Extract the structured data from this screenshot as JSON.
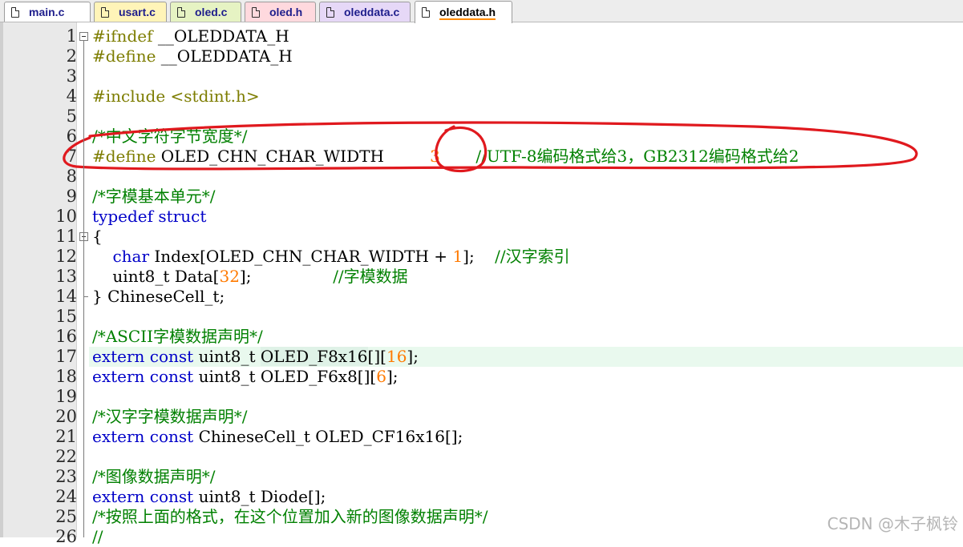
{
  "tabs": [
    {
      "label": "main.c",
      "color": "#ffffff"
    },
    {
      "label": "usart.c",
      "color": "#fff4b8"
    },
    {
      "label": "oled.c",
      "color": "#e6f3c3"
    },
    {
      "label": "oled.h",
      "color": "#ffd9de"
    },
    {
      "label": "oleddata.c",
      "color": "#e6d8f7"
    },
    {
      "label": "oleddata.h",
      "color": "#ffffff",
      "active": true
    }
  ],
  "icons": {
    "file": "file-icon",
    "fold": "fold-collapse-icon"
  },
  "colors": {
    "preprocessor": "#7d7d00",
    "keyword": "#0000c8",
    "number": "#ff7a00",
    "comment": "#008000",
    "annotation": "#e0191e",
    "current_line": "#e9f9ee"
  },
  "code": [
    {
      "n": "1",
      "tokens": [
        [
          "pp",
          "#ifndef"
        ],
        [
          "pl",
          " __OLEDDATA_H"
        ]
      ]
    },
    {
      "n": "2",
      "tokens": [
        [
          "pp",
          "#define"
        ],
        [
          "pl",
          " __OLEDDATA_H"
        ]
      ]
    },
    {
      "n": "3",
      "tokens": []
    },
    {
      "n": "4",
      "tokens": [
        [
          "pp",
          "#include <stdint.h>"
        ]
      ]
    },
    {
      "n": "5",
      "tokens": []
    },
    {
      "n": "6",
      "tokens": [
        [
          "cm",
          "/*中文字符字节宽度*/"
        ]
      ]
    },
    {
      "n": "7",
      "tokens": [
        [
          "pp",
          "#define"
        ],
        [
          "pl",
          " OLED_CHN_CHAR_WIDTH         "
        ],
        [
          "num",
          "3"
        ],
        [
          "pl",
          "       "
        ],
        [
          "cm",
          "//UTF-8编码格式给3，GB2312编码格式给2"
        ]
      ]
    },
    {
      "n": "8",
      "tokens": []
    },
    {
      "n": "9",
      "tokens": [
        [
          "cm",
          "/*字模基本单元*/"
        ]
      ]
    },
    {
      "n": "10",
      "tokens": [
        [
          "kw",
          "typedef struct"
        ]
      ]
    },
    {
      "n": "11",
      "tokens": [
        [
          "pl",
          "{"
        ]
      ]
    },
    {
      "n": "12",
      "tokens": [
        [
          "pl",
          "    "
        ],
        [
          "kw",
          "char"
        ],
        [
          "pl",
          " Index[OLED_CHN_CHAR_WIDTH + "
        ],
        [
          "num",
          "1"
        ],
        [
          "pl",
          "];    "
        ],
        [
          "cm",
          "//汉字索引"
        ]
      ]
    },
    {
      "n": "13",
      "tokens": [
        [
          "pl",
          "    uint8_t Data["
        ],
        [
          "num",
          "32"
        ],
        [
          "pl",
          "];                "
        ],
        [
          "cm",
          "//字模数据"
        ]
      ]
    },
    {
      "n": "14",
      "tokens": [
        [
          "pl",
          "} ChineseCell_t;"
        ]
      ]
    },
    {
      "n": "15",
      "tokens": []
    },
    {
      "n": "16",
      "tokens": [
        [
          "cm",
          "/*ASCII字模数据声明*/"
        ]
      ]
    },
    {
      "n": "17",
      "tokens": [
        [
          "kw",
          "extern const"
        ],
        [
          "pl",
          " uint8_t "
        ],
        [
          "sel",
          "OLED_F8x16"
        ],
        [
          "pl",
          "[]["
        ],
        [
          "num",
          "16"
        ],
        [
          "pl",
          "];"
        ]
      ],
      "current": true
    },
    {
      "n": "18",
      "tokens": [
        [
          "kw",
          "extern const"
        ],
        [
          "pl",
          " uint8_t OLED_F6x8[]["
        ],
        [
          "num",
          "6"
        ],
        [
          "pl",
          "];"
        ]
      ]
    },
    {
      "n": "19",
      "tokens": []
    },
    {
      "n": "20",
      "tokens": [
        [
          "cm",
          "/*汉字字模数据声明*/"
        ]
      ]
    },
    {
      "n": "21",
      "tokens": [
        [
          "kw",
          "extern const"
        ],
        [
          "pl",
          " ChineseCell_t OLED_CF16x16[];"
        ]
      ]
    },
    {
      "n": "22",
      "tokens": []
    },
    {
      "n": "23",
      "tokens": [
        [
          "cm",
          "/*图像数据声明*/"
        ]
      ]
    },
    {
      "n": "24",
      "tokens": [
        [
          "kw",
          "extern const"
        ],
        [
          "pl",
          " uint8_t Diode[];"
        ]
      ]
    },
    {
      "n": "25",
      "tokens": [
        [
          "cm",
          "/*按照上面的格式，在这个位置加入新的图像数据声明*/"
        ]
      ]
    },
    {
      "n": "26",
      "tokens": [
        [
          "cm",
          "//"
        ]
      ]
    }
  ],
  "watermark": "CSDN @木子枫铃"
}
